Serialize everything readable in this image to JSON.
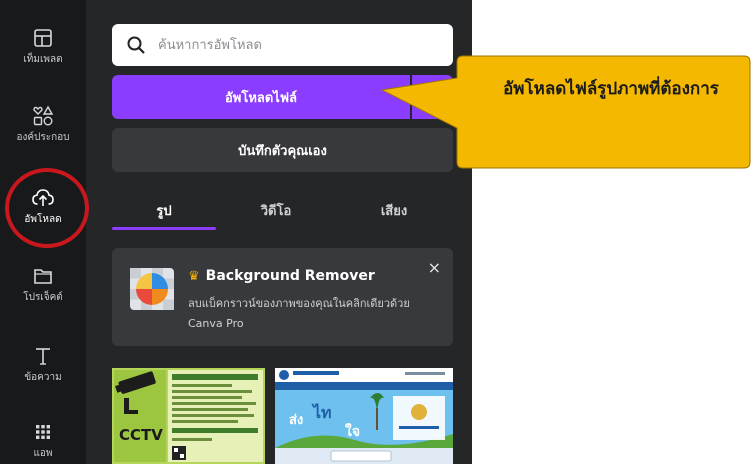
{
  "rail": {
    "items": [
      {
        "label": "เท็มเพลต",
        "icon": "template-icon"
      },
      {
        "label": "องค์ประกอบ",
        "icon": "elements-icon"
      },
      {
        "label": "อัพโหลด",
        "icon": "cloud-upload-icon",
        "active": true
      },
      {
        "label": "โปรเจ็คต์",
        "icon": "folder-icon"
      },
      {
        "label": "ข้อความ",
        "icon": "text-icon"
      },
      {
        "label": "แอพ",
        "icon": "apps-icon"
      }
    ]
  },
  "search": {
    "placeholder": "ค้นหาการอัพโหลด"
  },
  "upload_button": {
    "label": "อัพโหลดไฟล์",
    "more": "···"
  },
  "record_button": {
    "label": "บันทึกตัวคุณเอง"
  },
  "tabs": [
    {
      "label": "รูป",
      "active": true
    },
    {
      "label": "วิดีโอ"
    },
    {
      "label": "เสียง"
    }
  ],
  "promo": {
    "title": "Background Remover",
    "description": "ลบแบ็คกราวน์ของภาพของคุณในคลิกเดียวด้วย Canva Pro",
    "close": "×"
  },
  "uploads": [
    {
      "name": "cctv-image",
      "caption": "CCTV"
    },
    {
      "name": "website-screenshot"
    }
  ],
  "callout": {
    "text": "อัพโหลดไฟล์รูปภาพที่ต้องการ"
  },
  "colors": {
    "accent": "#8b3dff",
    "callout": "#f5b800",
    "highlight": "#c8181e"
  }
}
